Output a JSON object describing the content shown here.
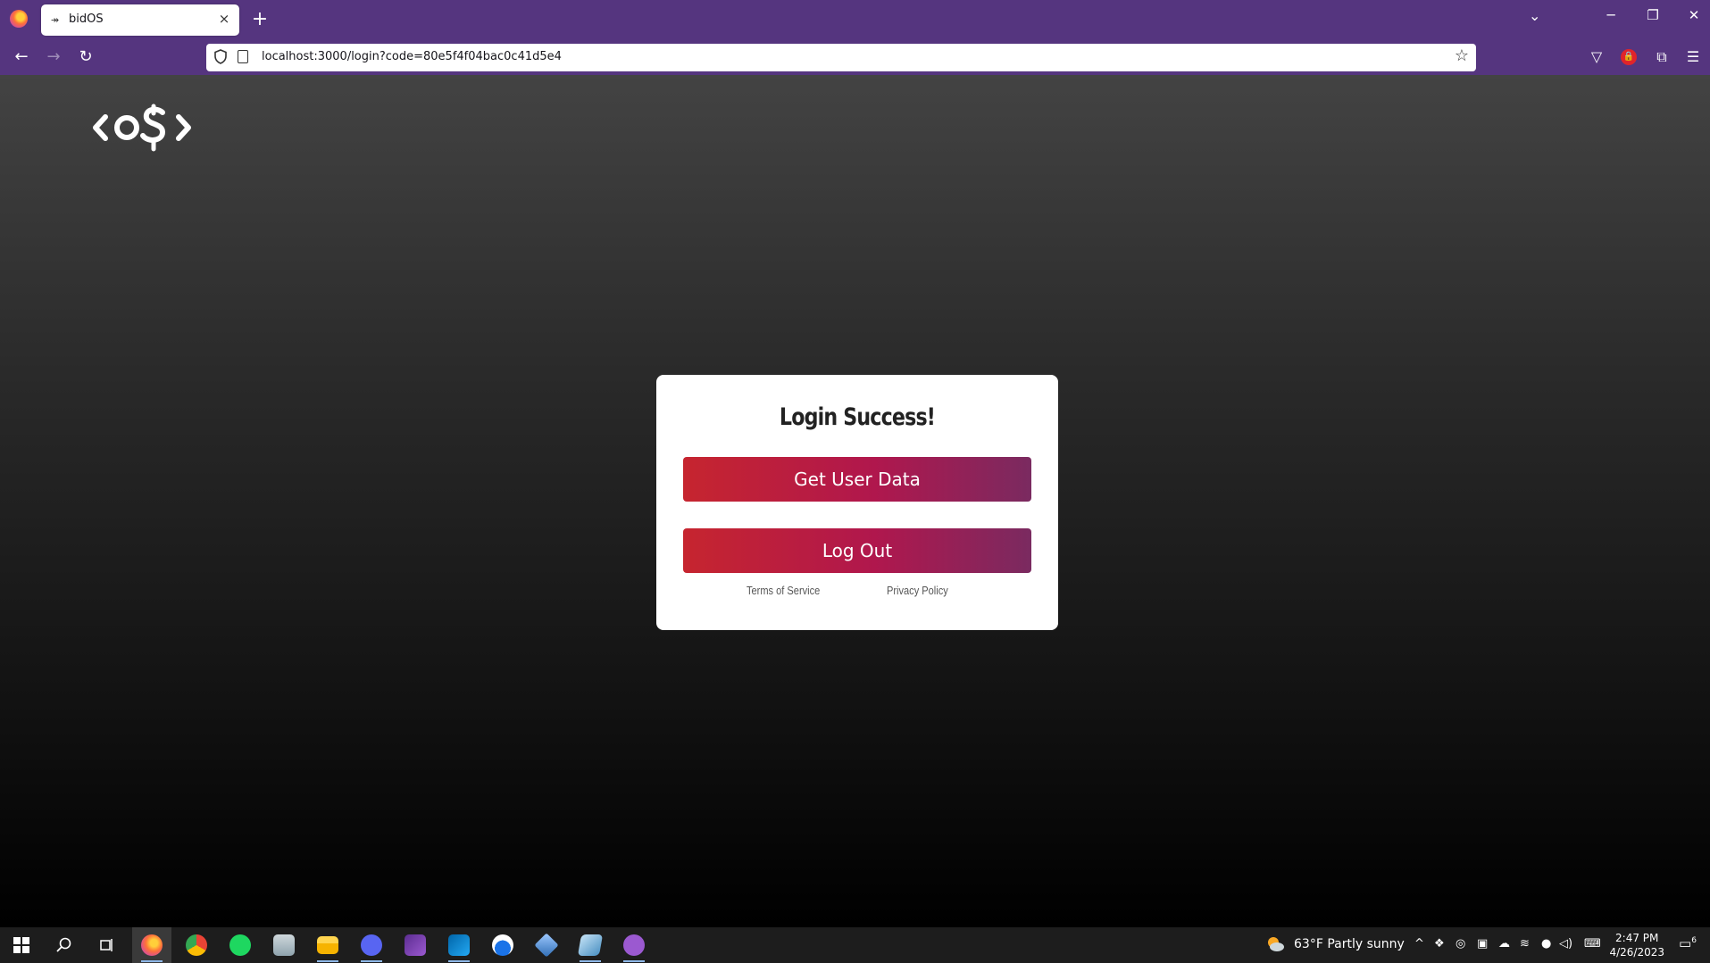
{
  "browser": {
    "tab_title": "bidOS",
    "tab_favicon": "↠",
    "new_tab_icon": "+",
    "url": "localhost:3000/login?code=80e5f4f04bac0c41d5e4",
    "icons": {
      "back": "←",
      "forward": "→",
      "reload": "↻",
      "bookmark": "☆",
      "list_tabs": "⌄",
      "minimize": "─",
      "restore": "❐",
      "close": "✕",
      "pocket": "▽",
      "extensions": "⧉",
      "menu": "☰",
      "tab_close": "×"
    },
    "accent_color": "#55357f"
  },
  "card": {
    "heading": "Login Success!",
    "get_user_data_button": "Get User Data",
    "logout_button": "Log Out",
    "terms_link": "Terms of Service",
    "privacy_link": "Privacy Policy",
    "button_gradient": [
      "#c6252f",
      "#b0174d",
      "#7a2a60"
    ]
  },
  "taskbar": {
    "weather": "63°F  Partly sunny",
    "time": "2:47 PM",
    "date": "4/26/2023",
    "notification_count": "6",
    "apps": [
      "windows-start-icon",
      "search-icon",
      "task-view-icon",
      "firefox-icon",
      "chrome-icon",
      "spotify-icon",
      "app-icon",
      "file-explorer-icon",
      "discord-icon",
      "visual-studio-icon",
      "vscode-icon",
      "app-icon",
      "virtualbox-icon",
      "app-icon",
      "github-desktop-icon"
    ]
  }
}
